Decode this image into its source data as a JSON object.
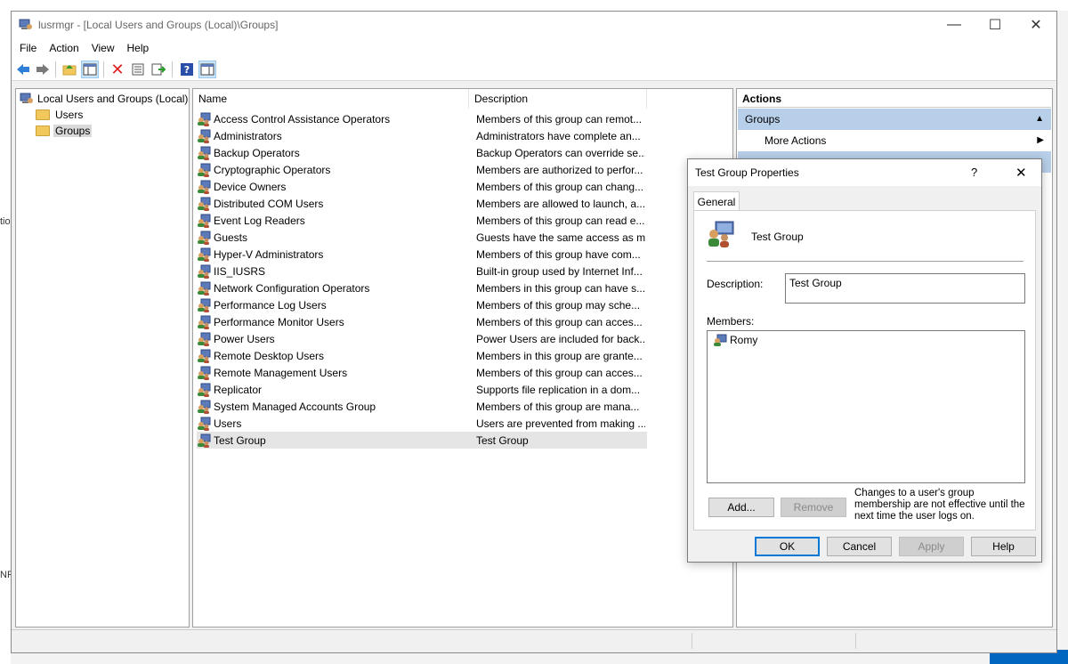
{
  "background": {
    "fragments": [
      "tio",
      "NF"
    ]
  },
  "window": {
    "title": "lusrmgr - [Local Users and Groups (Local)\\Groups]",
    "controls": {
      "minimize": "—",
      "maximize": "☐",
      "close": "✕"
    }
  },
  "menu": [
    "File",
    "Action",
    "View",
    "Help"
  ],
  "tree": {
    "root": "Local Users and Groups (Local)",
    "children": [
      "Users",
      "Groups"
    ]
  },
  "list": {
    "columns": [
      "Name",
      "Description"
    ],
    "rows": [
      {
        "name": "Access Control Assistance Operators",
        "description": "Members of this group can remot..."
      },
      {
        "name": "Administrators",
        "description": "Administrators have complete an..."
      },
      {
        "name": "Backup Operators",
        "description": "Backup Operators can override se..."
      },
      {
        "name": "Cryptographic Operators",
        "description": "Members are authorized to perfor..."
      },
      {
        "name": "Device Owners",
        "description": "Members of this group can chang..."
      },
      {
        "name": "Distributed COM Users",
        "description": "Members are allowed to launch, a..."
      },
      {
        "name": "Event Log Readers",
        "description": "Members of this group can read e..."
      },
      {
        "name": "Guests",
        "description": "Guests have the same access as m..."
      },
      {
        "name": "Hyper-V Administrators",
        "description": "Members of this group have com..."
      },
      {
        "name": "IIS_IUSRS",
        "description": "Built-in group used by Internet Inf..."
      },
      {
        "name": "Network Configuration Operators",
        "description": "Members in this group can have s..."
      },
      {
        "name": "Performance Log Users",
        "description": "Members of this group may sche..."
      },
      {
        "name": "Performance Monitor Users",
        "description": "Members of this group can acces..."
      },
      {
        "name": "Power Users",
        "description": "Power Users are included for back..."
      },
      {
        "name": "Remote Desktop Users",
        "description": "Members in this group are grante..."
      },
      {
        "name": "Remote Management Users",
        "description": "Members of this group can acces..."
      },
      {
        "name": "Replicator",
        "description": "Supports file replication in a dom..."
      },
      {
        "name": "System Managed Accounts Group",
        "description": "Members of this group are mana..."
      },
      {
        "name": "Users",
        "description": "Users are prevented from making ..."
      },
      {
        "name": "Test Group",
        "description": "Test Group",
        "selected": true
      }
    ]
  },
  "actions": {
    "header": "Actions",
    "section": "Groups",
    "item": "More Actions"
  },
  "dialog": {
    "title": "Test Group Properties",
    "help_glyph": "?",
    "close_glyph": "✕",
    "tab": "General",
    "group_name": "Test Group",
    "description_label": "Description:",
    "description_value": "Test Group",
    "members_label": "Members:",
    "members": [
      "Romy"
    ],
    "add_button": "Add...",
    "remove_button": "Remove",
    "note": "Changes to a user's group membership are not effective until the next time the user logs on.",
    "ok_button": "OK",
    "cancel_button": "Cancel",
    "apply_button": "Apply",
    "help_button": "Help"
  }
}
